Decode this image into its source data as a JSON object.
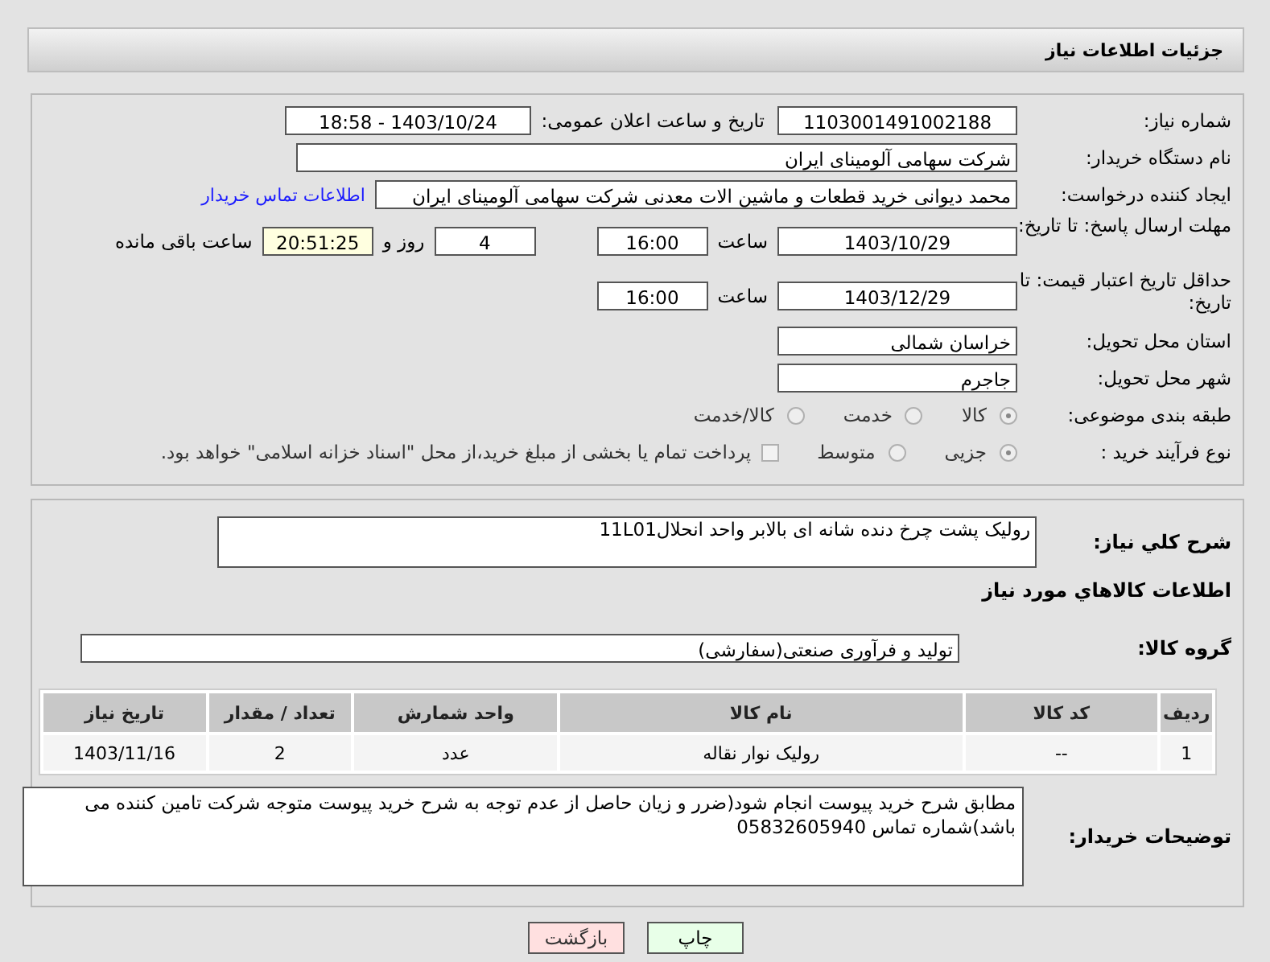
{
  "header": {
    "title": "جزئیات اطلاعات نیاز"
  },
  "need_number": {
    "label": "شماره نیاز:",
    "value": "1103001491002188"
  },
  "announce": {
    "label": "تاریخ و ساعت اعلان عمومی:",
    "value": "1403/10/24 - 18:58"
  },
  "buyer": {
    "label": "نام دستگاه خریدار:",
    "value": "شرکت سهامی آلومینای ایران"
  },
  "creator": {
    "label": "ایجاد کننده درخواست:",
    "value": "محمد دیوانی خرید قطعات و ماشین الات معدنی شرکت سهامی آلومینای ایران",
    "link": "اطلاعات تماس خریدار"
  },
  "reply_deadline": {
    "label": "مهلت ارسال پاسخ: تا تاریخ:",
    "date": "1403/10/29",
    "time_label": "ساعت",
    "time": "16:00",
    "days": "4",
    "days_label": "روز و",
    "remaining": "20:51:25",
    "remaining_label": "ساعت باقی مانده"
  },
  "price_validity": {
    "label": "حداقل تاریخ اعتبار قیمت: تا تاریخ:",
    "date": "1403/12/29",
    "time_label": "ساعت",
    "time": "16:00"
  },
  "province": {
    "label": "استان محل تحویل:",
    "value": "خراسان شمالی"
  },
  "city": {
    "label": "شهر محل تحویل:",
    "value": "جاجرم"
  },
  "category": {
    "label": "طبقه بندی موضوعی:",
    "options": [
      {
        "label": "کالا",
        "selected": true
      },
      {
        "label": "خدمت",
        "selected": false
      },
      {
        "label": "کالا/خدمت",
        "selected": false
      }
    ]
  },
  "process": {
    "label": "نوع فرآیند خرید :",
    "options": [
      {
        "label": "جزیی",
        "selected": true
      },
      {
        "label": "متوسط",
        "selected": false
      }
    ],
    "treasury": {
      "checked": false,
      "text": "پرداخت تمام یا بخشی از مبلغ خرید،از محل \"اسناد خزانه اسلامی\" خواهد بود."
    }
  },
  "description": {
    "label": "شرح کلي نياز:",
    "value": "رولیک پشت چرخ دنده شانه ای بالابر واحد انحلال11L01"
  },
  "goods_title": "اطلاعات کالاهاي مورد نياز",
  "goods_group": {
    "label": "گروه کالا:",
    "value": "تولید و فرآوری صنعتی(سفارشی)"
  },
  "table": {
    "columns": [
      "ردیف",
      "کد کالا",
      "نام کالا",
      "واحد شمارش",
      "تعداد / مقدار",
      "تاریخ نیاز"
    ],
    "rows": [
      [
        "1",
        "--",
        "رولیک نوار نقاله",
        "عدد",
        "2",
        "1403/11/16"
      ]
    ]
  },
  "buyer_notes": {
    "label": "توضیحات خریدار:",
    "value": "مطابق شرح خرید پیوست انجام شود(ضرر و زیان حاصل از عدم توجه به شرح خرید پیوست متوجه شرکت تامین کننده می باشد)شماره تماس 05832605940"
  },
  "buttons": [
    {
      "label": "چاپ",
      "kind": "print"
    },
    {
      "label": "بازگشت",
      "kind": "back"
    }
  ]
}
